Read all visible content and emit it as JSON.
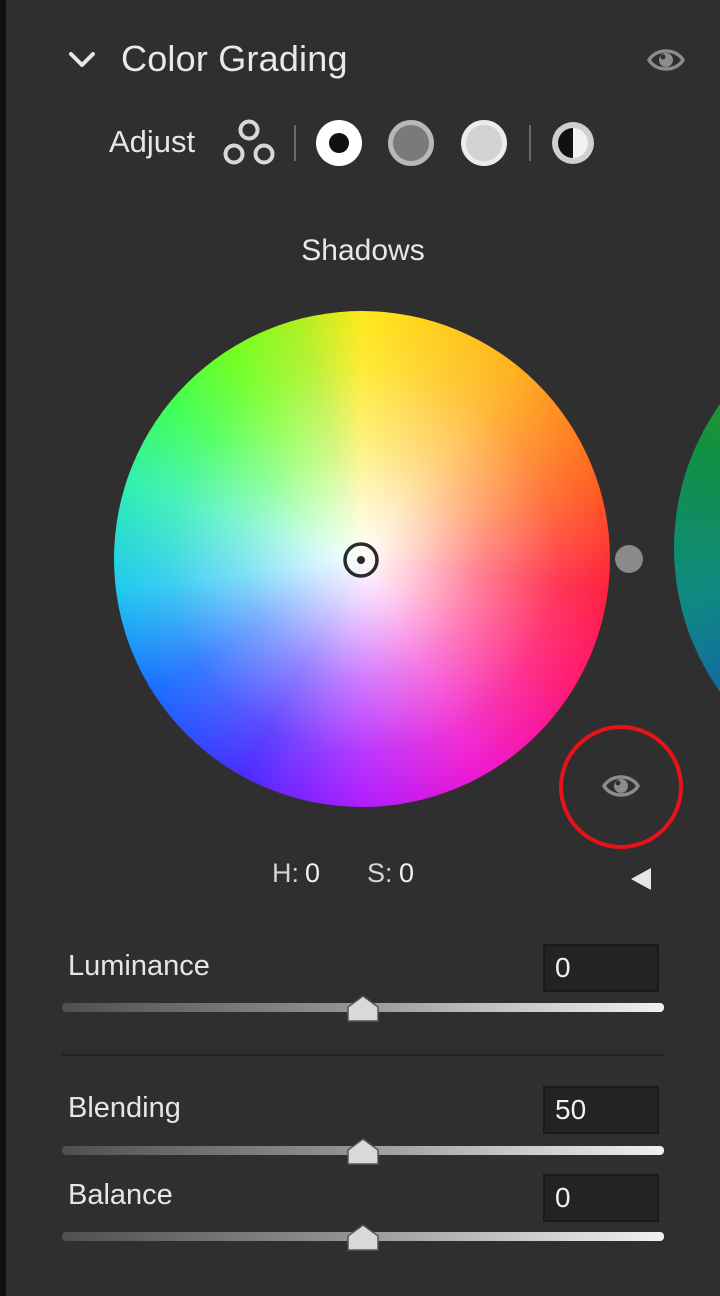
{
  "header": {
    "title": "Color Grading",
    "expand_icon": "chevron-down-icon",
    "visibility_icon": "eye-icon"
  },
  "adjust": {
    "label": "Adjust",
    "modes": [
      {
        "name": "3-way",
        "icon": "three-circles-icon"
      },
      {
        "name": "shadows",
        "icon": "shadows-circle-icon",
        "selected": true
      },
      {
        "name": "midtones",
        "icon": "midtones-circle-icon"
      },
      {
        "name": "highlights",
        "icon": "highlights-circle-icon"
      },
      {
        "name": "global",
        "icon": "half-filled-circle-icon"
      }
    ]
  },
  "wheel": {
    "title": "Shadows",
    "h_label": "H:",
    "h_value": "0",
    "s_label": "S:",
    "s_value": "0",
    "eye_icon": "eye-icon",
    "collapse_icon": "left-triangle-icon"
  },
  "sliders": {
    "luminance": {
      "label": "Luminance",
      "value": "0",
      "level": 0.5
    },
    "blending": {
      "label": "Blending",
      "value": "50",
      "level": 0.5
    },
    "balance": {
      "label": "Balance",
      "value": "0",
      "level": 0.5
    }
  },
  "colors": {
    "panel_bg": "#2f2f2f",
    "annotation": "#e8121a",
    "text": "#e6e6e6"
  }
}
